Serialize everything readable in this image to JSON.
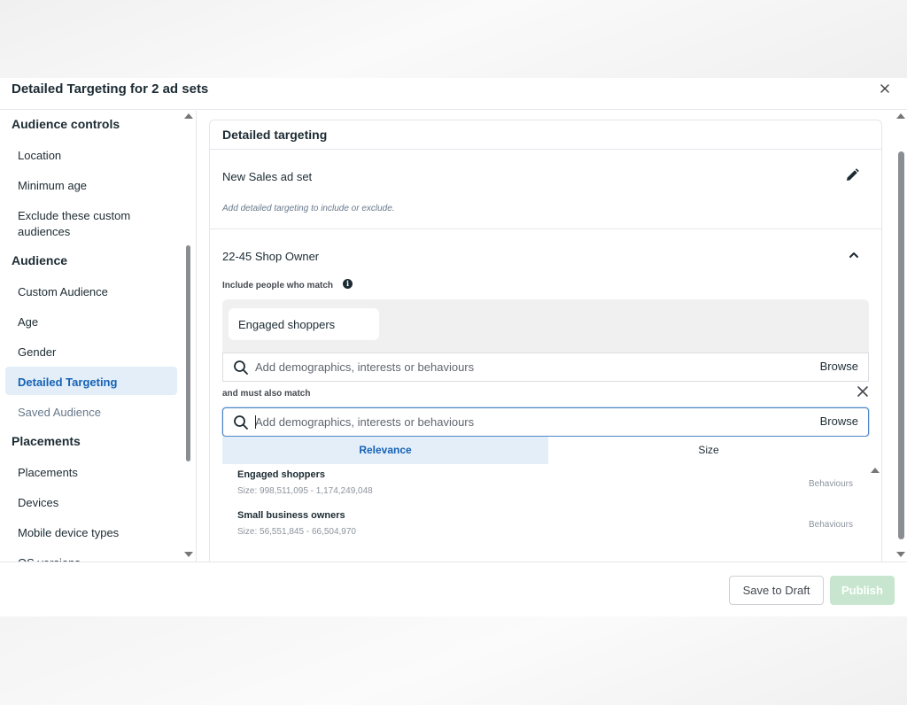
{
  "dialog": {
    "title": "Detailed Targeting for 2 ad sets",
    "close_icon": "close-icon"
  },
  "sidebar": {
    "sections": [
      {
        "title": "Audience controls",
        "items": [
          {
            "label": "Location"
          },
          {
            "label": "Minimum age"
          },
          {
            "label": "Exclude these custom audiences"
          }
        ]
      },
      {
        "title": "Audience",
        "items": [
          {
            "label": "Custom Audience"
          },
          {
            "label": "Age"
          },
          {
            "label": "Gender"
          },
          {
            "label": "Detailed Targeting",
            "active": true
          },
          {
            "label": "Saved Audience",
            "muted": true
          }
        ]
      },
      {
        "title": "Placements",
        "items": [
          {
            "label": "Placements"
          },
          {
            "label": "Devices"
          },
          {
            "label": "Mobile device types"
          },
          {
            "label": "OS versions"
          }
        ]
      }
    ]
  },
  "main": {
    "card_title": "Detailed targeting",
    "adsets": [
      {
        "name": "New Sales ad set",
        "hint": "Add detailed targeting to include or exclude.",
        "action_icon": "pencil-icon"
      },
      {
        "name": "22-45 Shop Owner",
        "action_icon": "chevron-up-icon",
        "include_label": "Include people who match",
        "include_chips": [
          "Engaged shoppers"
        ],
        "include_search_placeholder": "Add demographics, interests or behaviours",
        "browse_label": "Browse",
        "must_label": "and must also match",
        "must_search_placeholder": "Add demographics, interests or behaviours",
        "tabs": [
          {
            "label": "Relevance",
            "active": true
          },
          {
            "label": "Size",
            "active": false
          }
        ],
        "results": [
          {
            "name": "Engaged shoppers",
            "size": "Size: 998,511,095 - 1,174,249,048",
            "category": "Behaviours"
          },
          {
            "name": "Small business owners",
            "size": "Size: 56,551,845 - 66,504,970",
            "category": "Behaviours"
          }
        ]
      }
    ]
  },
  "footer": {
    "save_draft_label": "Save to Draft",
    "publish_label": "Publish"
  },
  "colors": {
    "accent_blue": "#1562b5",
    "active_bg": "#e3eef9",
    "publish_disabled": "#c8e6cf"
  }
}
